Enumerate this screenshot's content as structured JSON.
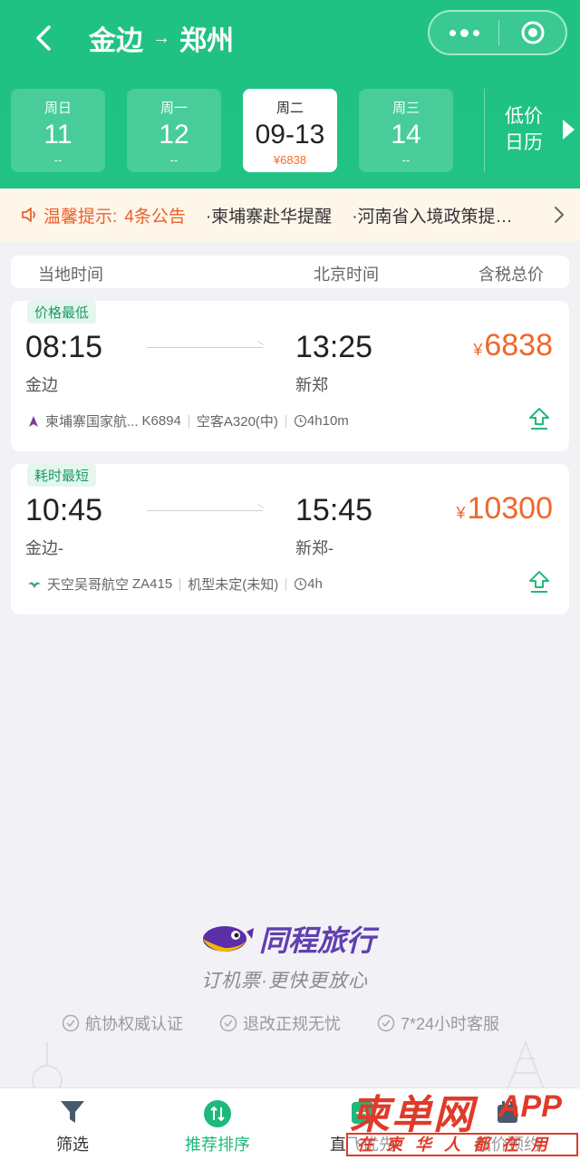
{
  "header": {
    "from_city": "金边",
    "to_city": "郑州",
    "arrow": "→"
  },
  "dates": [
    {
      "weekday": "周日",
      "date": "11",
      "price": "--",
      "active": false
    },
    {
      "weekday": "周一",
      "date": "12",
      "price": "--",
      "active": false
    },
    {
      "weekday": "周二",
      "date": "09-13",
      "price": "¥6838",
      "active": true
    },
    {
      "weekday": "周三",
      "date": "14",
      "price": "--",
      "active": false
    }
  ],
  "calendar": {
    "line1": "低价",
    "line2": "日历"
  },
  "notice": {
    "label": "温馨提示:",
    "count": "4条公告",
    "items": [
      "·柬埔寨赴华提醒",
      "·河南省入境政策提…"
    ]
  },
  "columns": {
    "local_time": "当地时间",
    "beijing_time": "北京时间",
    "total_price": "含税总价"
  },
  "flights": [
    {
      "tag": "价格最低",
      "dep_time": "08:15",
      "dep_city": "金边",
      "arr_time": "13:25",
      "arr_city": "新郑",
      "currency": "¥",
      "price": "6838",
      "airline": "柬埔寨国家航...",
      "flight_no": "K6894",
      "aircraft": "空客A320(中)",
      "duration": "4h10m"
    },
    {
      "tag": "耗时最短",
      "dep_time": "10:45",
      "dep_city": "金边-",
      "arr_time": "15:45",
      "arr_city": "新郑-",
      "currency": "¥",
      "price": "10300",
      "airline": "天空吴哥航空",
      "flight_no": "ZA415",
      "aircraft": "机型未定(未知)",
      "duration": "4h"
    }
  ],
  "brand": {
    "name": "同程旅行",
    "slogan": "订机票·更快更放心"
  },
  "badges": [
    "航协权威认证",
    "退改正规无忧",
    "7*24小时客服"
  ],
  "tabs": [
    {
      "label": "筛选",
      "icon": "filter-icon"
    },
    {
      "label": "推荐排序",
      "icon": "sort-icon"
    },
    {
      "label": "直飞优先",
      "icon": "direct-icon"
    },
    {
      "label": "低价预约",
      "icon": "reserve-icon"
    }
  ],
  "watermark": {
    "main": "柬单网",
    "app": "APP",
    "sub": "在柬华人都在用"
  },
  "colors": {
    "primary": "#21c384",
    "price": "#f0672c",
    "notice_bg": "#fff6ea"
  }
}
